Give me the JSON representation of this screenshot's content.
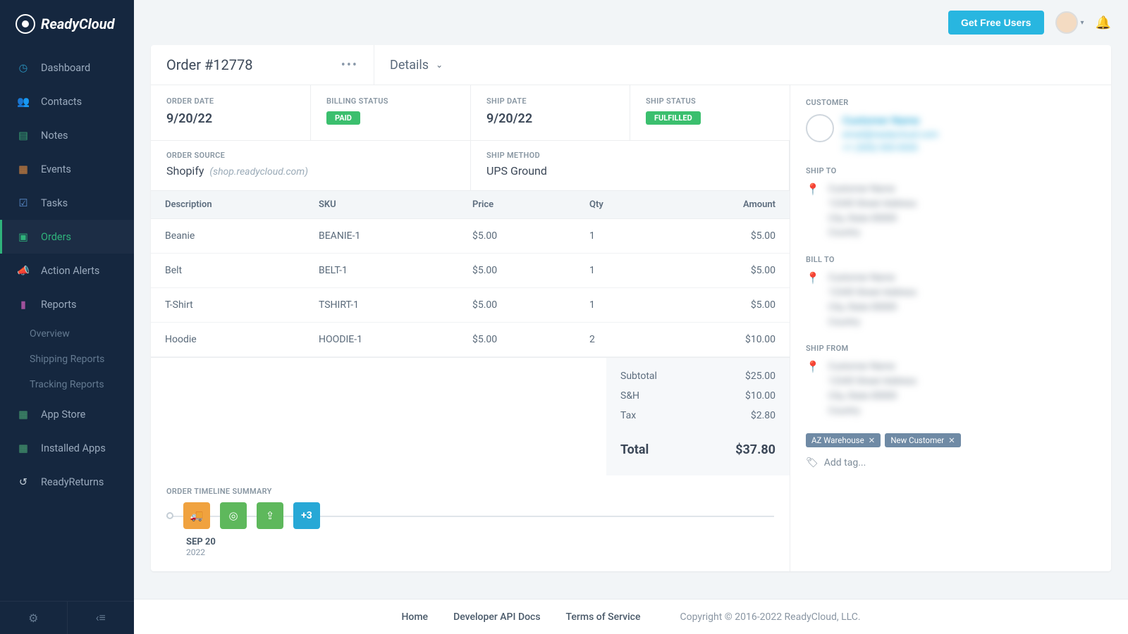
{
  "brand": "ReadyCloud",
  "topbar": {
    "cta": "Get Free Users"
  },
  "sidebar": {
    "items": [
      {
        "label": "Dashboard",
        "icon": "gauge"
      },
      {
        "label": "Contacts",
        "icon": "users"
      },
      {
        "label": "Notes",
        "icon": "clipboard"
      },
      {
        "label": "Events",
        "icon": "calendar"
      },
      {
        "label": "Tasks",
        "icon": "checklist"
      },
      {
        "label": "Orders",
        "icon": "box",
        "active": true
      },
      {
        "label": "Action Alerts",
        "icon": "megaphone"
      },
      {
        "label": "Reports",
        "icon": "chart",
        "subs": [
          "Overview",
          "Shipping Reports",
          "Tracking Reports"
        ]
      },
      {
        "label": "App Store",
        "icon": "grid"
      },
      {
        "label": "Installed Apps",
        "icon": "grid"
      },
      {
        "label": "ReadyReturns",
        "icon": "return"
      }
    ]
  },
  "order": {
    "title": "Order #12778",
    "dropdown": "Details",
    "meta": {
      "order_date_label": "ORDER DATE",
      "order_date": "9/20/22",
      "billing_status_label": "BILLING STATUS",
      "billing_status": "PAID",
      "ship_date_label": "SHIP DATE",
      "ship_date": "9/20/22",
      "ship_status_label": "SHIP STATUS",
      "ship_status": "FULFILLED",
      "customer_label": "CUSTOMER",
      "order_source_label": "ORDER SOURCE",
      "order_source": "Shopify",
      "order_source_sub": "(shop.readycloud.com)",
      "ship_method_label": "SHIP METHOD",
      "ship_method": "UPS Ground"
    },
    "table": {
      "headers": {
        "desc": "Description",
        "sku": "SKU",
        "price": "Price",
        "qty": "Qty",
        "amount": "Amount"
      },
      "rows": [
        {
          "desc": "Beanie",
          "sku": "BEANIE-1",
          "price": "$5.00",
          "qty": "1",
          "amount": "$5.00"
        },
        {
          "desc": "Belt",
          "sku": "BELT-1",
          "price": "$5.00",
          "qty": "1",
          "amount": "$5.00"
        },
        {
          "desc": "T-Shirt",
          "sku": "TSHIRT-1",
          "price": "$5.00",
          "qty": "1",
          "amount": "$5.00"
        },
        {
          "desc": "Hoodie",
          "sku": "HOODIE-1",
          "price": "$5.00",
          "qty": "2",
          "amount": "$10.00"
        }
      ]
    },
    "totals": {
      "subtotal_label": "Subtotal",
      "subtotal": "$25.00",
      "sh_label": "S&H",
      "sh": "$10.00",
      "tax_label": "Tax",
      "tax": "$2.80",
      "total_label": "Total",
      "total": "$37.80"
    },
    "timeline": {
      "label": "ORDER TIMELINE SUMMARY",
      "more": "+3",
      "date_main": "SEP 20",
      "date_sub": "2022"
    }
  },
  "customer_panel": {
    "name": "Customer Name",
    "email": "email@readycloud.com",
    "phone": "+1 (555) 555-5555",
    "shipto_label": "SHIP TO",
    "billto_label": "BILL TO",
    "shipfrom_label": "SHIP FROM",
    "addr_lines": [
      "Customer Name",
      "12345 Street Address",
      "City, State 00000",
      "Country"
    ],
    "tags": [
      "AZ Warehouse",
      "New Customer"
    ],
    "add_tag": "Add tag..."
  },
  "footer": {
    "home": "Home",
    "api": "Developer API Docs",
    "tos": "Terms of Service",
    "copy": "Copyright © 2016-2022 ReadyCloud, LLC."
  }
}
